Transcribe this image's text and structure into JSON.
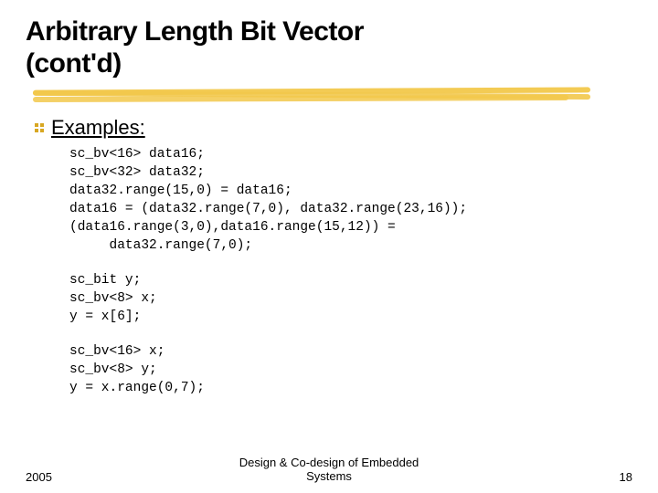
{
  "title_line1": "Arbitrary Length Bit Vector",
  "title_line2": "(cont'd)",
  "bullet_label": "Examples:",
  "code1": "sc_bv<16> data16;\nsc_bv<32> data32;\ndata32.range(15,0) = data16;\ndata16 = (data32.range(7,0), data32.range(23,16));\n(data16.range(3,0),data16.range(15,12)) =\n     data32.range(7,0);",
  "code2": "sc_bit y;\nsc_bv<8> x;\ny = x[6];",
  "code3": "sc_bv<16> x;\nsc_bv<8> y;\ny = x.range(0,7);",
  "footer_year": "2005",
  "footer_center": "Design & Co-design of Embedded\nSystems",
  "footer_page": "18"
}
